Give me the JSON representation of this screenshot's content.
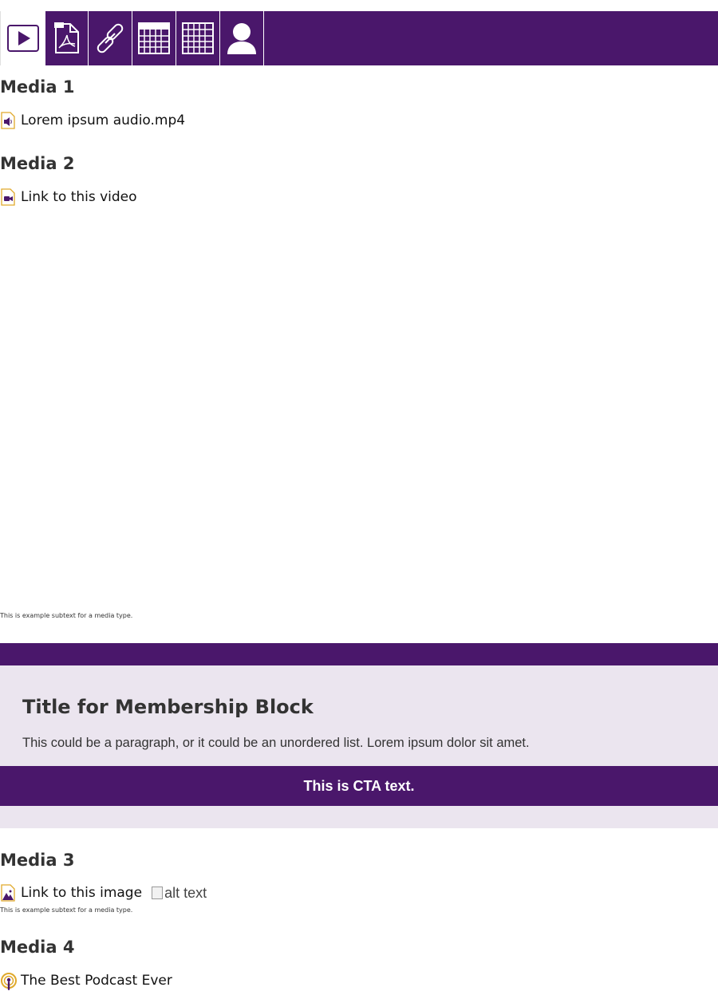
{
  "tabs": [
    {
      "icon": "play-icon"
    },
    {
      "icon": "pdf-icon"
    },
    {
      "icon": "link-icon"
    },
    {
      "icon": "calendar-icon"
    },
    {
      "icon": "grid-icon"
    },
    {
      "icon": "user-icon"
    }
  ],
  "colors": {
    "brand": "#4a176b",
    "panel": "#ebe5ef",
    "icon_accent": "#e0a92b"
  },
  "media1": {
    "heading": "Media 1",
    "link": "Lorem ipsum audio.mp4",
    "icon": "audio-file-icon"
  },
  "media2": {
    "heading": "Media 2",
    "link": "Link to this video",
    "icon": "video-file-icon",
    "subtext": "This is example subtext for a media type."
  },
  "membership": {
    "title": "Title for Membership Block",
    "text": "This could be a paragraph, or it could be an unordered list. Lorem ipsum dolor sit amet.",
    "cta": "This is CTA text."
  },
  "media3": {
    "heading": "Media 3",
    "link": "Link to this image",
    "icon": "image-file-icon",
    "alt": "alt text",
    "subtext": "This is example subtext for a media type."
  },
  "media4": {
    "heading": "Media 4",
    "link": "The Best Podcast Ever",
    "icon": "podcast-icon"
  }
}
